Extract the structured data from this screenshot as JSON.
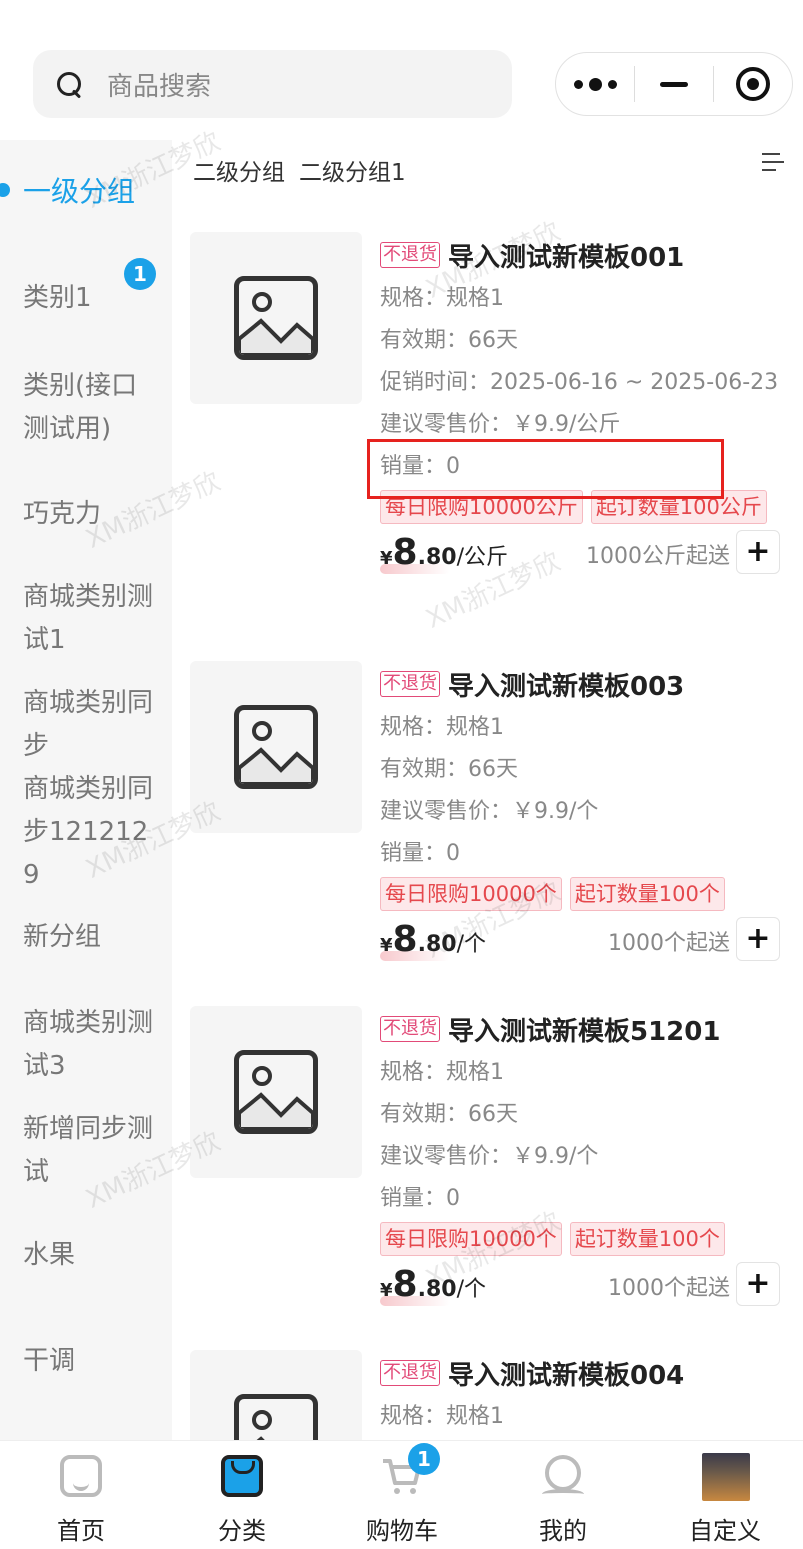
{
  "search": {
    "placeholder": "商品搜索"
  },
  "sidebar": {
    "items": [
      {
        "label": "一级分组",
        "active": true
      },
      {
        "label": "类别1",
        "badge": "1"
      },
      {
        "label": "类别(接口测试用)"
      },
      {
        "label": "巧克力"
      },
      {
        "label": "商城类别测试1"
      },
      {
        "label": "商城类别同步"
      },
      {
        "label": "商城类别同步1212129"
      },
      {
        "label": "新分组"
      },
      {
        "label": "商城类别测试3"
      },
      {
        "label": "新增同步测试"
      },
      {
        "label": "水果"
      },
      {
        "label": "干调"
      }
    ]
  },
  "subgroups": [
    "二级分组",
    "二级分组1"
  ],
  "products": [
    {
      "tag": "不退货",
      "title": "导入测试新模板001",
      "spec": "规格：规格1",
      "validity": "有效期：66天",
      "promo": "促销时间：2025-06-16 ~ 2025-06-23",
      "retail": "建议零售价：￥9.9/公斤",
      "sales": "销量：0",
      "limit_daily": "每日限购10000公斤",
      "limit_min": "起订数量100公斤",
      "price_currency": "¥",
      "price_int": "8",
      "price_dec": ".80",
      "price_unit": "/公斤",
      "min_order": "1000公斤起送"
    },
    {
      "tag": "不退货",
      "title": "导入测试新模板003",
      "spec": "规格：规格1",
      "validity": "有效期：66天",
      "retail": "建议零售价：￥9.9/个",
      "sales": "销量：0",
      "limit_daily": "每日限购10000个",
      "limit_min": "起订数量100个",
      "price_currency": "¥",
      "price_int": "8",
      "price_dec": ".80",
      "price_unit": "/个",
      "min_order": "1000个起送"
    },
    {
      "tag": "不退货",
      "title": "导入测试新模板51201",
      "spec": "规格：规格1",
      "validity": "有效期：66天",
      "retail": "建议零售价：￥9.9/个",
      "sales": "销量：0",
      "limit_daily": "每日限购10000个",
      "limit_min": "起订数量100个",
      "price_currency": "¥",
      "price_int": "8",
      "price_dec": ".80",
      "price_unit": "/个",
      "min_order": "1000个起送"
    },
    {
      "tag": "不退货",
      "title": "导入测试新模板004",
      "spec": "规格：规格1"
    }
  ],
  "watermark": "XM浙江梦欣",
  "tabbar": {
    "items": [
      {
        "label": "首页"
      },
      {
        "label": "分类",
        "active": true
      },
      {
        "label": "购物车",
        "badge": "1"
      },
      {
        "label": "我的"
      },
      {
        "label": "自定义"
      }
    ]
  },
  "colors": {
    "accent": "#1ba1e8",
    "tag": "#e24a78",
    "limit": "#e5484d",
    "highlight": "#e6221e"
  }
}
